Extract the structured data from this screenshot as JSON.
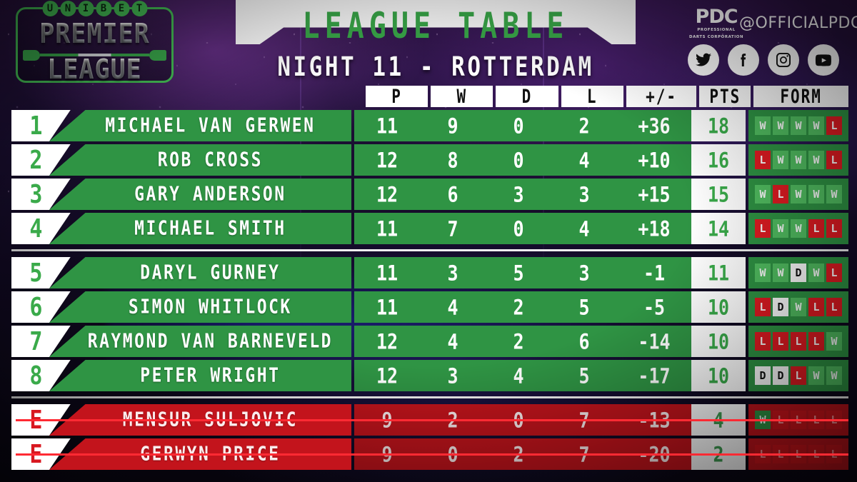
{
  "brand": {
    "unibet_letters": [
      "U",
      "N",
      "I",
      "B",
      "E",
      "T"
    ],
    "premier": "PREMIER",
    "league": "LEAGUE"
  },
  "header": {
    "title": "LEAGUE TABLE",
    "subtitle": "NIGHT 11 - ROTTERDAM",
    "pdc_word": "PDC",
    "pdc_sub_line1": "PROFESSIONAL",
    "pdc_sub_line2": "DARTS CORPORATION",
    "handle": "@OFFICIALPDC",
    "socials": [
      "twitter-icon",
      "facebook-icon",
      "instagram-icon",
      "youtube-icon"
    ]
  },
  "columns": {
    "p": "P",
    "w": "W",
    "d": "D",
    "l": "L",
    "plusminus": "+/-",
    "pts": "PTS",
    "form": "FORM"
  },
  "colors": {
    "green_row": "#2f9444",
    "green_accent": "#3aaa4a",
    "red_row": "#c3141c",
    "form_win": "#52c062",
    "form_loss": "#e21b22",
    "form_draw": "#ffffff",
    "strike": "#ff2a33"
  },
  "groups": [
    {
      "id": "qualified",
      "rows": [
        {
          "pos": "1",
          "name": "MICHAEL VAN GERWEN",
          "p": "11",
          "w": "9",
          "d": "0",
          "l": "2",
          "pm": "+36",
          "pts": "18",
          "form": [
            "W",
            "W",
            "W",
            "W",
            "L"
          ],
          "eliminated": false
        },
        {
          "pos": "2",
          "name": "ROB CROSS",
          "p": "12",
          "w": "8",
          "d": "0",
          "l": "4",
          "pm": "+10",
          "pts": "16",
          "form": [
            "L",
            "W",
            "W",
            "W",
            "L"
          ],
          "eliminated": false
        },
        {
          "pos": "3",
          "name": "GARY ANDERSON",
          "p": "12",
          "w": "6",
          "d": "3",
          "l": "3",
          "pm": "+15",
          "pts": "15",
          "form": [
            "W",
            "L",
            "W",
            "W",
            "W"
          ],
          "eliminated": false
        },
        {
          "pos": "4",
          "name": "MICHAEL SMITH",
          "p": "11",
          "w": "7",
          "d": "0",
          "l": "4",
          "pm": "+18",
          "pts": "14",
          "form": [
            "L",
            "W",
            "W",
            "L",
            "L"
          ],
          "eliminated": false
        }
      ]
    },
    {
      "id": "mid-table",
      "rows": [
        {
          "pos": "5",
          "name": "DARYL GURNEY",
          "p": "11",
          "w": "3",
          "d": "5",
          "l": "3",
          "pm": "-1",
          "pts": "11",
          "form": [
            "W",
            "W",
            "D",
            "W",
            "L"
          ],
          "eliminated": false
        },
        {
          "pos": "6",
          "name": "SIMON WHITLOCK",
          "p": "11",
          "w": "4",
          "d": "2",
          "l": "5",
          "pm": "-5",
          "pts": "10",
          "form": [
            "L",
            "D",
            "W",
            "L",
            "L"
          ],
          "eliminated": false
        },
        {
          "pos": "7",
          "name": "RAYMOND VAN BARNEVELD",
          "p": "12",
          "w": "4",
          "d": "2",
          "l": "6",
          "pm": "-14",
          "pts": "10",
          "form": [
            "L",
            "L",
            "L",
            "L",
            "W"
          ],
          "eliminated": false
        },
        {
          "pos": "8",
          "name": "PETER WRIGHT",
          "p": "12",
          "w": "3",
          "d": "4",
          "l": "5",
          "pm": "-17",
          "pts": "10",
          "form": [
            "D",
            "D",
            "L",
            "W",
            "W"
          ],
          "eliminated": false
        }
      ]
    },
    {
      "id": "eliminated",
      "rows": [
        {
          "pos": "E",
          "name": "MENSUR SULJOVIC",
          "p": "9",
          "w": "2",
          "d": "0",
          "l": "7",
          "pm": "-13",
          "pts": "4",
          "form": [
            "W",
            "L",
            "L",
            "L",
            "L"
          ],
          "eliminated": true
        },
        {
          "pos": "E",
          "name": "GERWYN PRICE",
          "p": "9",
          "w": "0",
          "d": "2",
          "l": "7",
          "pm": "-20",
          "pts": "2",
          "form": [
            "L",
            "L",
            "L",
            "L",
            "L"
          ],
          "eliminated": true
        }
      ]
    }
  ]
}
